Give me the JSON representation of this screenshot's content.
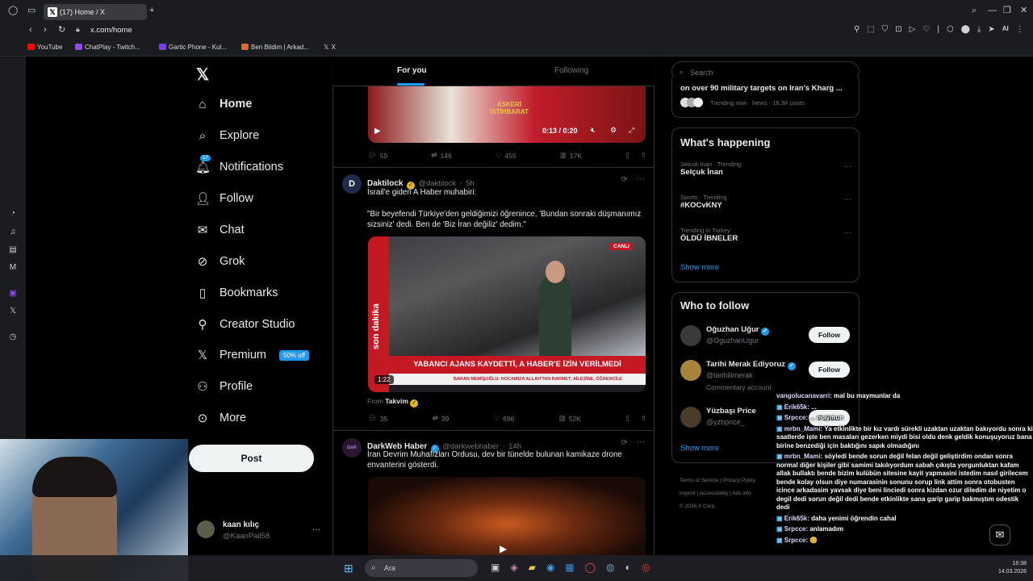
{
  "browser": {
    "tab_title": "(17) Home / X",
    "url": "x.com/home",
    "bookmarks": [
      {
        "label": "YouTube",
        "color": "#ff0000"
      },
      {
        "label": "ChatPlay - Twitch...",
        "color": "#9146ff"
      },
      {
        "label": "Gartic Phone - Kul...",
        "color": "#7a3cff"
      },
      {
        "label": "Ben Bildim | Arkad...",
        "color": "#e06a2c"
      },
      {
        "label": "X",
        "color": "#ffffff"
      }
    ],
    "ai_label": "AI"
  },
  "nav": {
    "items": [
      {
        "label": "Home",
        "icon": "home-icon"
      },
      {
        "label": "Explore",
        "icon": "search-icon"
      },
      {
        "label": "Notifications",
        "icon": "bell-icon",
        "badge": "17"
      },
      {
        "label": "Follow",
        "icon": "person-add-icon"
      },
      {
        "label": "Chat",
        "icon": "mail-icon"
      },
      {
        "label": "Grok",
        "icon": "grok-icon"
      },
      {
        "label": "Bookmarks",
        "icon": "bookmark-icon"
      },
      {
        "label": "Creator Studio",
        "icon": "rocket-icon"
      },
      {
        "label": "Premium",
        "icon": "x-icon",
        "badge": "50% off"
      },
      {
        "label": "Profile",
        "icon": "person-icon"
      },
      {
        "label": "More",
        "icon": "more-icon"
      }
    ],
    "post_label": "Post",
    "account": {
      "name": "kaan kılıç",
      "handle": "@KaanPail58"
    }
  },
  "timeline": {
    "tabs": [
      "For you",
      "Following"
    ],
    "tweet1": {
      "video_text": "ASKERİ İSTİHBARAT",
      "time": "0:13 / 0:20",
      "replies": "59",
      "reposts": "146",
      "likes": "455",
      "views": "17K"
    },
    "tweet2": {
      "name": "Daktilock",
      "handle": "@daktilock",
      "time": "5h",
      "line1": "İsrail'e giden A Haber muhabiri:",
      "line2": "\"Bir beyefendi Türkiye'den geldiğimizi öğrenince, 'Bundan sonraki düşmanımız sizsiniz' dedi. Ben de 'Biz İran değiliz' dedim.\"",
      "video_headline": "YABANCI AJANS KAYDETTİ, A HABER'E İZİN VERİLMEDİ",
      "video_side": "son dakika",
      "video_ticker": "BAKAN MEMİŞOĞLU: HOCAMIZA ALLAH'TAN RAHMET; AİLESİNE, ÖĞRENCİLE",
      "video_duration": "1:22",
      "live_label": "CANLI",
      "from_label": "From",
      "from_name": "Takvim",
      "replies": "35",
      "reposts": "39",
      "likes": "696",
      "views": "52K"
    },
    "tweet3": {
      "name": "DarkWeb Haber",
      "handle": "@darkwebhaber",
      "time": "14h",
      "text": "İran Devrim Muhafızları Ordusu, dev bir tünelde bulunan kamikaze drone envanterini gösterdi."
    }
  },
  "right": {
    "search_placeholder": "Search",
    "top_story": {
      "title": "on over 90 military targets on Iran's Kharg ...",
      "meta": "Trending now · News · 16.3K posts"
    },
    "happening_title": "What's happening",
    "trends": [
      {
        "meta": "Selcuk Inan · Trending",
        "name": "Selçuk İnan"
      },
      {
        "meta": "Sports · Trending",
        "name": "#KOCvKNY"
      },
      {
        "meta": "Trending in Turkey",
        "name": "ÖLDÜ İBNELER"
      }
    ],
    "show_more": "Show more",
    "who_title": "Who to follow",
    "follow": [
      {
        "name": "Oğuzhan Uğur",
        "handle": "@OguzhanUgur",
        "note": ""
      },
      {
        "name": "Tarihi Merak Ediyoruz",
        "handle": "@tarihilimerak",
        "note": "Commentary account"
      },
      {
        "name": "Yüzbaşı Price",
        "handle": "@yzbprice_",
        "note": ""
      }
    ],
    "follow_label": "Follow",
    "footer": [
      "Terms of Service",
      "Privacy Policy",
      "Imprint",
      "Accessibility",
      "Ads info",
      "© 2026 X Corp."
    ]
  },
  "chat": [
    {
      "user": "vangolucanavarri",
      "msg": ": mal bu maymunlar da"
    },
    {
      "user": "Erik65k",
      "msg": ": ..."
    },
    {
      "user": "Srpcce",
      "msg": ": ... maymun"
    },
    {
      "user": "mrbn_Mami",
      "msg": ": Ya etkinlikte bir kız vardı sürekli uzaktan uzaktan bakıyordu sonra ki saatlerde işte ben masaları gezerken miydi bisi oldu denk geldik konuşuyoruz bana birine benzediği için baktığını sapık olmadığını"
    },
    {
      "user": "mrbn_Mami",
      "msg": ": söyledi bende sorun değil felan değil geliştirdim ondan sonra normal diğer kişiler gibi samimi takılıyordum sabah çıkışta yorgunluktan kafam allak bullaktı bende bizim kulübün sitesine kayit yapmasini istedim nasıl girilecem bende kolay olsun diye numarasinin sonunu sorup link attim sonra otobusten icince arkadasim yavsak diye beni linciedi sonra kizdan ozur diledim de niyetim o degil dedi sorun değil dedi bende etkinlikte sana garip garip bakmıştım odestik dedi"
    },
    {
      "user": "Erik65k",
      "msg": ": daha yenimi öğrendin cahal"
    },
    {
      "user": "Srpcce",
      "msg": ": anlamadım"
    },
    {
      "user": "Srpcce",
      "msg": ": 😊"
    }
  ],
  "taskbar": {
    "search_label": "Ara",
    "time": "16:38",
    "date": "14.03.2026"
  }
}
